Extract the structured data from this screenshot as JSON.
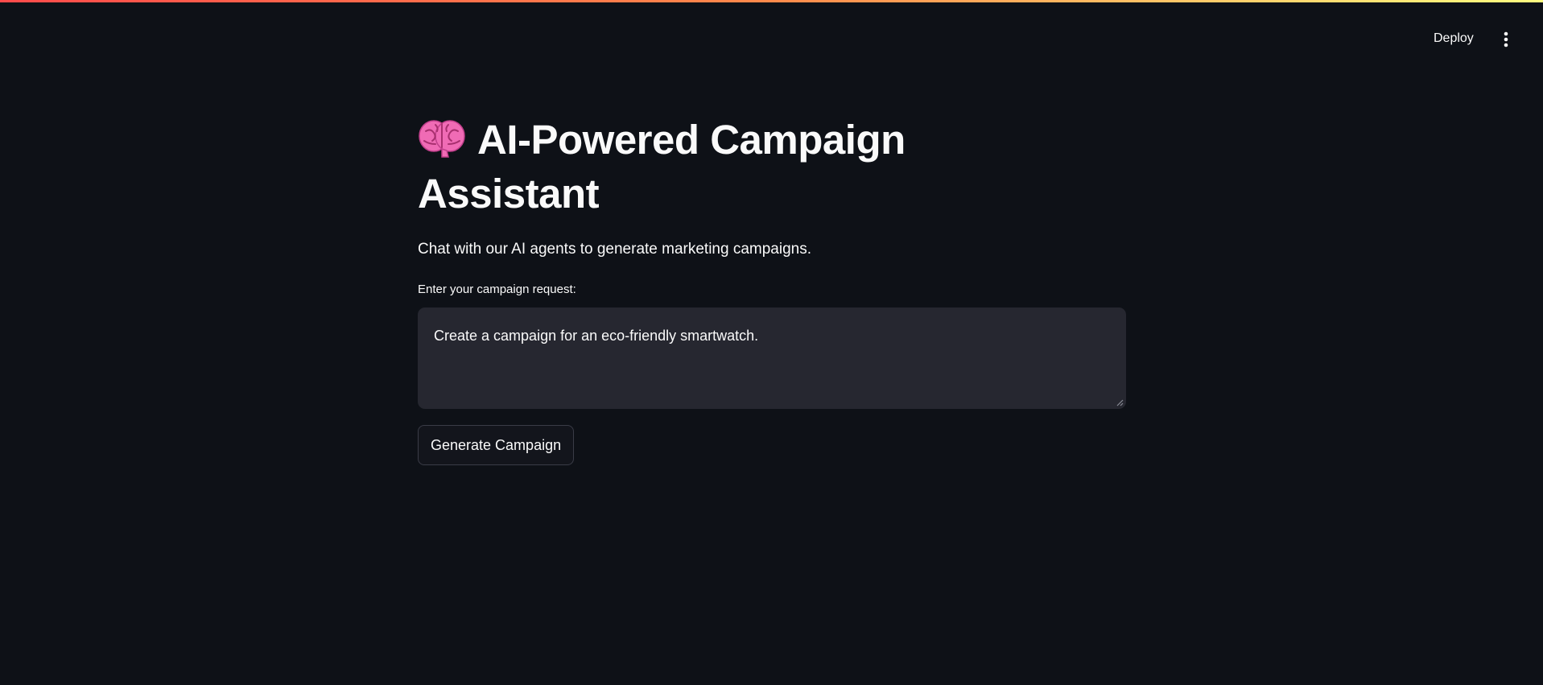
{
  "header": {
    "deploy_label": "Deploy",
    "menu_icon": "vertical-ellipsis-icon"
  },
  "main": {
    "title_icon": "brain-icon",
    "title": "AI-Powered Campaign Assistant",
    "subtitle": "Chat with our AI agents to generate marketing campaigns.",
    "input_label": "Enter your campaign request:",
    "input_value": "Create a campaign for an eco-friendly smartwatch.",
    "button_label": "Generate Campaign"
  },
  "colors": {
    "background": "#0e1117",
    "text": "#fafafa",
    "input_background": "#262730",
    "brain_icon": "#f06bb5",
    "top_gradient": [
      "#ff4b4b",
      "#fffd80"
    ]
  }
}
